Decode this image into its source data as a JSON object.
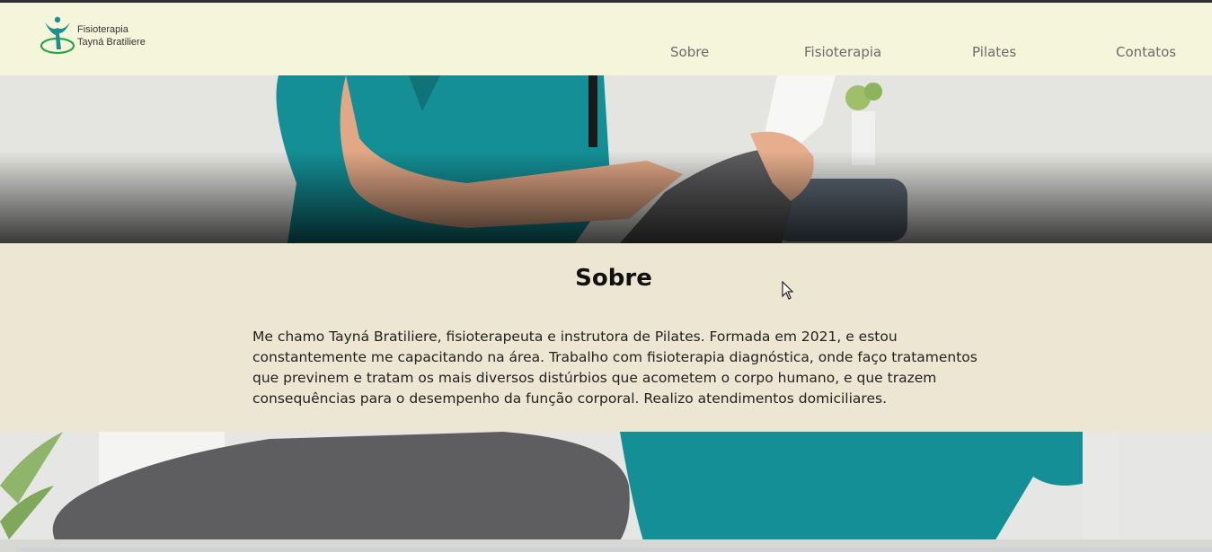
{
  "brand": {
    "line1": "Fisioterapia",
    "line2": "Tayná Bratiliere",
    "icon": "physio-figure-logo"
  },
  "nav": {
    "items": [
      {
        "label": "Sobre"
      },
      {
        "label": "Fisioterapia"
      },
      {
        "label": "Pilates"
      },
      {
        "label": "Contatos"
      }
    ]
  },
  "about": {
    "title": "Sobre",
    "text": "Me chamo Tayná Bratiliere, fisioterapeuta e instrutora de Pilates. Formada em 2021, e estou constantemente me capacitando na área. Trabalho com fisioterapia diagnóstica, onde faço tratamentos que previnem e tratam os mais diversos distúrbios que acometem o corpo humano, e que trazem consequências para o desempenho da função corporal. Realizo atendimentos domiciliares."
  },
  "colors": {
    "header_bg": "#f5f5dc",
    "section_bg": "#ece6d3",
    "logo_teal": "#1e8f8f",
    "logo_green": "#2aa34a",
    "scrub_teal": "#138f95",
    "pants_gray": "#5e5e60"
  }
}
